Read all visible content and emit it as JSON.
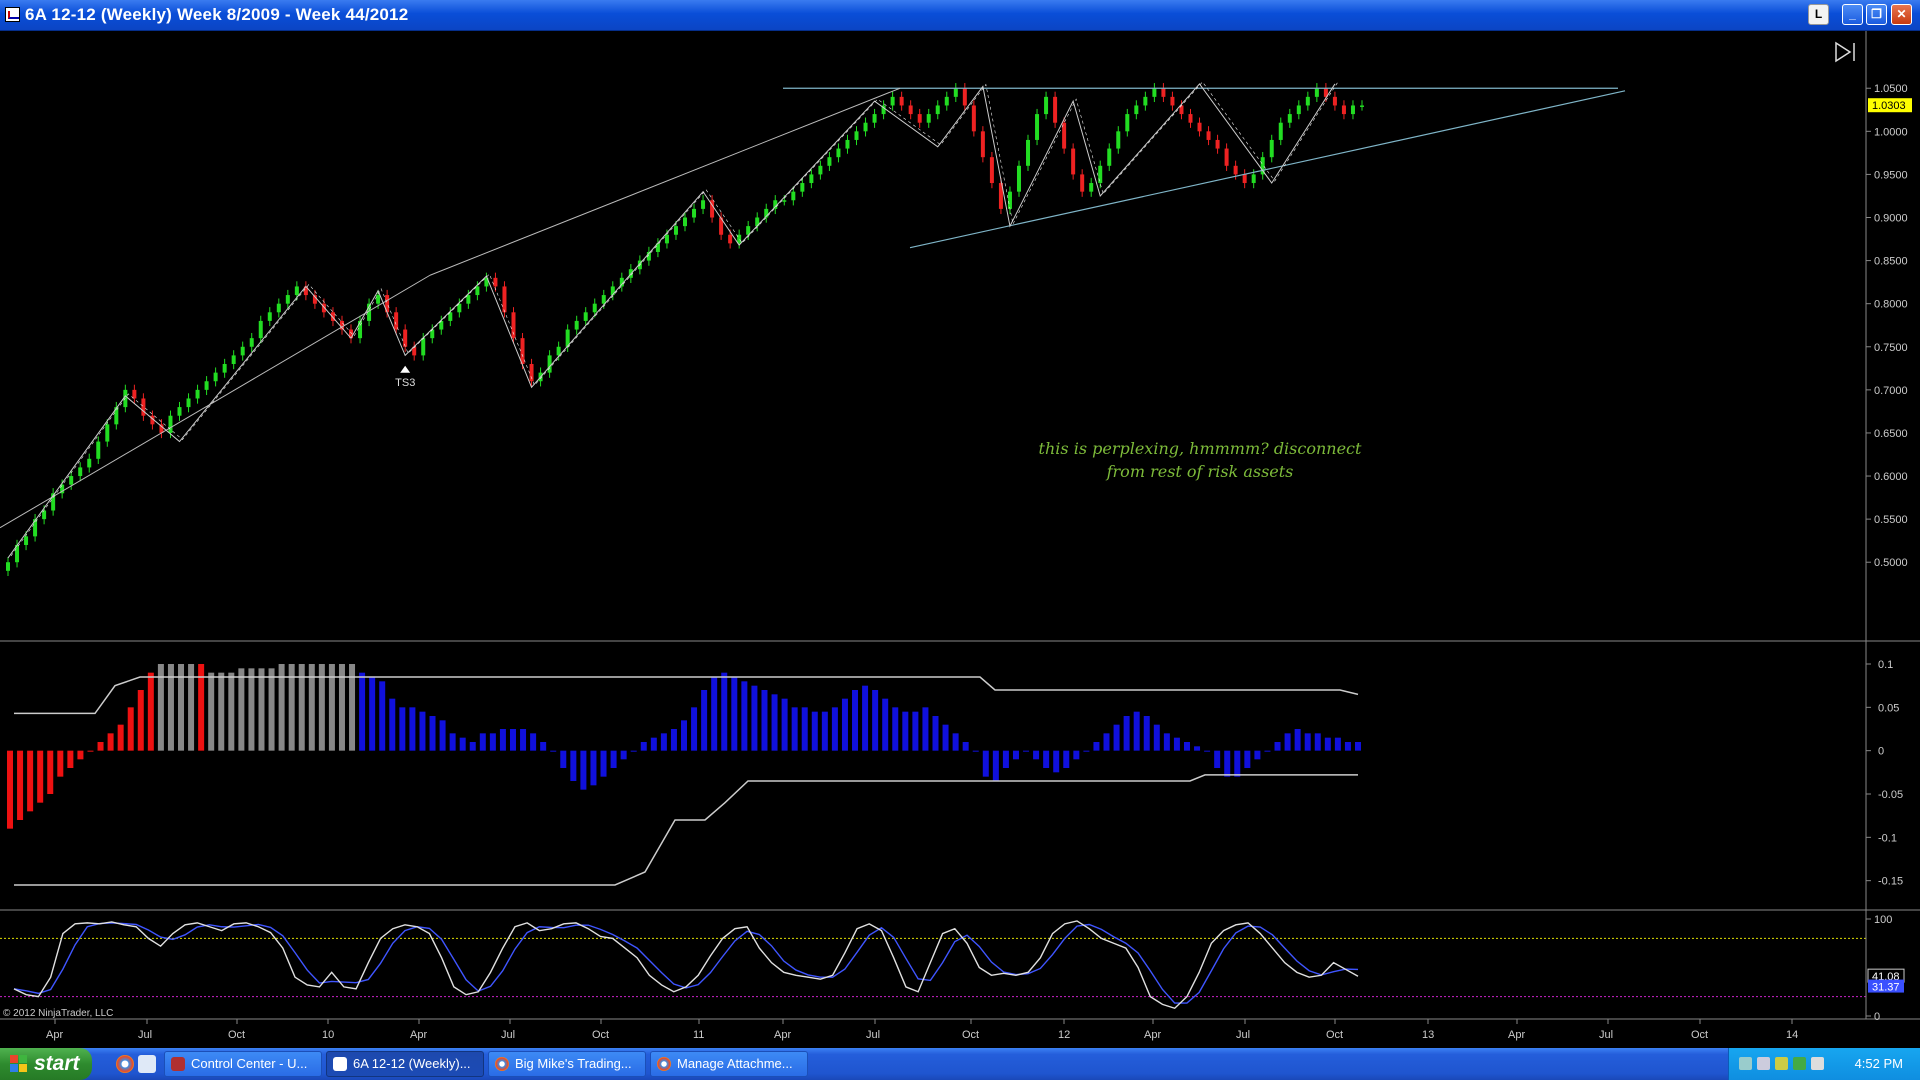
{
  "window": {
    "title": "6A 12-12 (Weekly)  Week 8/2009 - Week 44/2012",
    "link_label": "L",
    "minimize_label": "_",
    "restore_label": "❐",
    "close_label": "✕"
  },
  "price_panel": {
    "current_price": "1.0303",
    "y_ticks": [
      "1.0500",
      "1.0000",
      "0.9500",
      "0.9000",
      "0.8500",
      "0.8000",
      "0.7500",
      "0.7000",
      "0.6500",
      "0.6000",
      "0.5500",
      "0.5000"
    ],
    "marker_label": "TS3"
  },
  "annotation": {
    "line1": "this is perplexing, hmmmm? disconnect",
    "line2": "from rest of risk assets"
  },
  "histogram_panel": {
    "y_ticks": [
      "0.1",
      "0.05",
      "0",
      "-0.05",
      "-0.1",
      "-0.15"
    ]
  },
  "stochastic_panel": {
    "y_ticks": [
      "100",
      "0"
    ],
    "value_a": "41.08",
    "value_b": "31.37"
  },
  "copyright": "© 2012 NinjaTrader, LLC",
  "x_axis": {
    "labels": [
      "Apr",
      "Jul",
      "Oct",
      "10",
      "Apr",
      "Jul",
      "Oct",
      "11",
      "Apr",
      "Jul",
      "Oct",
      "12",
      "Apr",
      "Jul",
      "Oct",
      "13",
      "Apr",
      "Jul",
      "Oct",
      "14"
    ]
  },
  "taskbar": {
    "start_label": "start",
    "tasks": [
      "Control Center - U...",
      "6A 12-12 (Weekly)...",
      "Big Mike's Trading...",
      "Manage Attachme..."
    ],
    "clock": "4:52 PM"
  },
  "chart_data": {
    "type": "candlestick",
    "title": "6A 12-12 (Weekly)  Week 8/2009 - Week 44/2012",
    "ylim": [
      0.455,
      1.07
    ],
    "last_price": 1.0303,
    "close": [
      0.5,
      0.52,
      0.53,
      0.55,
      0.56,
      0.58,
      0.59,
      0.6,
      0.61,
      0.62,
      0.64,
      0.66,
      0.68,
      0.7,
      0.69,
      0.67,
      0.66,
      0.65,
      0.67,
      0.68,
      0.69,
      0.7,
      0.71,
      0.72,
      0.73,
      0.74,
      0.75,
      0.76,
      0.78,
      0.79,
      0.8,
      0.81,
      0.82,
      0.81,
      0.8,
      0.79,
      0.78,
      0.77,
      0.76,
      0.78,
      0.8,
      0.81,
      0.79,
      0.77,
      0.75,
      0.74,
      0.76,
      0.77,
      0.78,
      0.79,
      0.8,
      0.81,
      0.82,
      0.83,
      0.82,
      0.79,
      0.76,
      0.73,
      0.71,
      0.72,
      0.74,
      0.75,
      0.77,
      0.78,
      0.79,
      0.8,
      0.81,
      0.82,
      0.83,
      0.84,
      0.85,
      0.86,
      0.87,
      0.88,
      0.89,
      0.9,
      0.91,
      0.92,
      0.9,
      0.88,
      0.87,
      0.88,
      0.89,
      0.9,
      0.91,
      0.92,
      0.92,
      0.93,
      0.94,
      0.95,
      0.96,
      0.97,
      0.98,
      0.99,
      1.0,
      1.01,
      1.02,
      1.03,
      1.04,
      1.03,
      1.02,
      1.01,
      1.02,
      1.03,
      1.04,
      1.05,
      1.03,
      1.0,
      0.97,
      0.94,
      0.91,
      0.93,
      0.96,
      0.99,
      1.02,
      1.04,
      1.01,
      0.98,
      0.95,
      0.93,
      0.94,
      0.96,
      0.98,
      1.0,
      1.02,
      1.03,
      1.04,
      1.05,
      1.04,
      1.03,
      1.02,
      1.01,
      1.0,
      0.99,
      0.98,
      0.96,
      0.95,
      0.94,
      0.95,
      0.97,
      0.99,
      1.01,
      1.02,
      1.03,
      1.04,
      1.05,
      1.04,
      1.03,
      1.02,
      1.03,
      1.03
    ],
    "trendlines": [
      {
        "name": "resistance",
        "points": [
          [
            "2011-04",
            1.05
          ],
          [
            "2013-07",
            1.05
          ]
        ]
      },
      {
        "name": "rising-support",
        "points": [
          [
            "2011-07",
            0.865
          ],
          [
            "2013-07",
            1.045
          ]
        ]
      }
    ],
    "histogram": {
      "values": [
        -0.09,
        -0.08,
        -0.07,
        -0.06,
        -0.05,
        -0.03,
        -0.02,
        -0.01,
        0.0,
        0.01,
        0.02,
        0.03,
        0.05,
        0.07,
        0.09,
        0.1,
        0.1,
        0.1,
        0.1,
        0.1,
        0.09,
        0.09,
        0.09,
        0.095,
        0.095,
        0.095,
        0.095,
        0.1,
        0.1,
        0.1,
        0.1,
        0.1,
        0.1,
        0.1,
        0.1,
        0.09,
        0.085,
        0.08,
        0.06,
        0.05,
        0.05,
        0.045,
        0.04,
        0.035,
        0.02,
        0.015,
        0.01,
        0.02,
        0.02,
        0.025,
        0.025,
        0.025,
        0.02,
        0.01,
        0.0,
        -0.02,
        -0.035,
        -0.045,
        -0.04,
        -0.03,
        -0.02,
        -0.01,
        0.0,
        0.01,
        0.015,
        0.02,
        0.025,
        0.035,
        0.05,
        0.07,
        0.085,
        0.09,
        0.085,
        0.08,
        0.075,
        0.07,
        0.065,
        0.06,
        0.05,
        0.05,
        0.045,
        0.045,
        0.05,
        0.06,
        0.07,
        0.075,
        0.07,
        0.06,
        0.05,
        0.045,
        0.045,
        0.05,
        0.04,
        0.03,
        0.02,
        0.01,
        0.0,
        -0.03,
        -0.035,
        -0.02,
        -0.01,
        0.0,
        -0.01,
        -0.02,
        -0.025,
        -0.02,
        -0.01,
        0.0,
        0.01,
        0.02,
        0.03,
        0.04,
        0.045,
        0.04,
        0.03,
        0.02,
        0.015,
        0.01,
        0.005,
        0.0,
        -0.02,
        -0.03,
        -0.03,
        -0.02,
        -0.01,
        0.0,
        0.01,
        0.02,
        0.025,
        0.02,
        0.02,
        0.015,
        0.015,
        0.01,
        0.01
      ],
      "upper_band": 0.085,
      "lower_band": -0.155
    },
    "stochastic": {
      "ylim": [
        0,
        100
      ],
      "k_last": 41.08,
      "d_last": 31.37,
      "levels": [
        80,
        20
      ]
    }
  }
}
